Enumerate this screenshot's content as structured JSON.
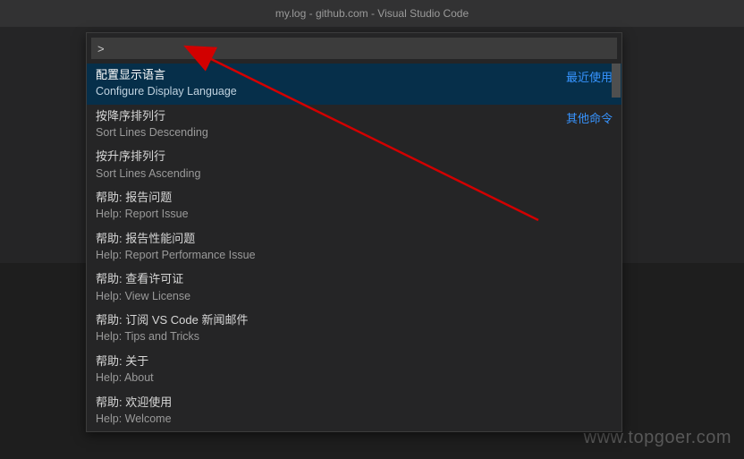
{
  "title": "my.log - github.com - Visual Studio Code",
  "watermark": "www.topgoer.com",
  "palette": {
    "input_value": ">",
    "recent_tag": "最近使用",
    "other_tag": "其他命令",
    "items": [
      {
        "cn": "配置显示语言",
        "en": "Configure Display Language"
      },
      {
        "cn": "按降序排列行",
        "en": "Sort Lines Descending"
      },
      {
        "cn": "按升序排列行",
        "en": "Sort Lines Ascending"
      },
      {
        "cn": "帮助: 报告问题",
        "en": "Help: Report Issue"
      },
      {
        "cn": "帮助: 报告性能问题",
        "en": "Help: Report Performance Issue"
      },
      {
        "cn": "帮助: 查看许可证",
        "en": "Help: View License"
      },
      {
        "cn": "帮助: 订阅 VS Code 新闻邮件",
        "en": "Help: Tips and Tricks"
      },
      {
        "cn": "帮助: 关于",
        "en": "Help: About"
      },
      {
        "cn": "帮助: 欢迎使用",
        "en": "Help: Welcome"
      }
    ]
  }
}
